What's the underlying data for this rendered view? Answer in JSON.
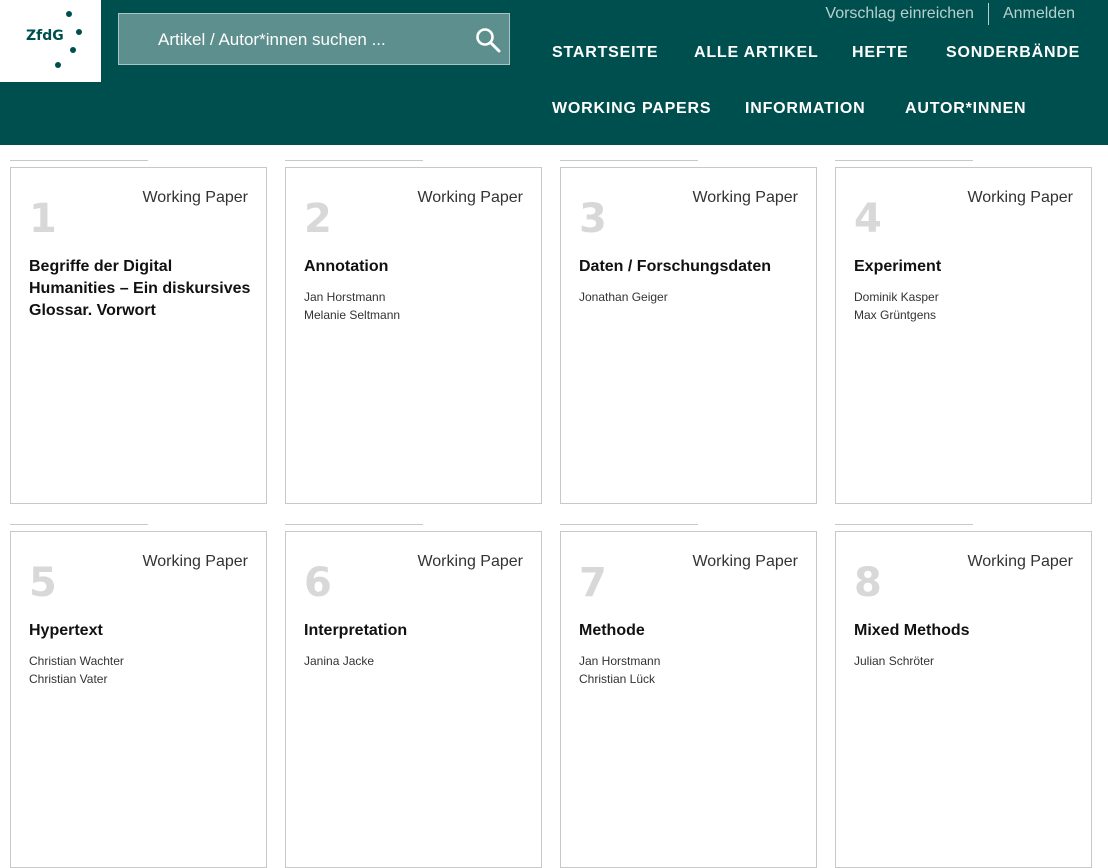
{
  "logo": {
    "text": "ZfdG"
  },
  "search": {
    "placeholder": "Artikel / Autor*innen suchen ..."
  },
  "util_links": [
    "Vorschlag einreichen",
    "Anmelden"
  ],
  "nav": {
    "row1": [
      "STARTSEITE",
      "ALLE ARTIKEL",
      "HEFTE",
      "SONDERBÄNDE"
    ],
    "row2": [
      "WORKING PAPERS",
      "INFORMATION",
      "AUTOR*INNEN"
    ]
  },
  "tiles": [
    {
      "number": "1",
      "type": "Working Paper",
      "title": "Begriffe der Digital Humanities – Ein diskursives Glossar. Vorwort",
      "authors": []
    },
    {
      "number": "2",
      "type": "Working Paper",
      "title": "Annotation",
      "authors": [
        "Jan Horstmann",
        "Melanie Seltmann"
      ]
    },
    {
      "number": "3",
      "type": "Working Paper",
      "title": "Daten / Forschungsdaten",
      "authors": [
        "Jonathan Geiger"
      ]
    },
    {
      "number": "4",
      "type": "Working Paper",
      "title": "Experiment",
      "authors": [
        "Dominik Kasper",
        "Max Grüntgens"
      ]
    },
    {
      "number": "5",
      "type": "Working Paper",
      "title": "Hypertext",
      "authors": [
        "Christian Wachter",
        "Christian Vater"
      ]
    },
    {
      "number": "6",
      "type": "Working Paper",
      "title": "Interpretation",
      "authors": [
        "Janina Jacke"
      ]
    },
    {
      "number": "7",
      "type": "Working Paper",
      "title": "Methode",
      "authors": [
        "Jan Horstmann",
        "Christian Lück"
      ]
    },
    {
      "number": "8",
      "type": "Working Paper",
      "title": "Mixed Methods",
      "authors": [
        "Julian Schröter"
      ]
    }
  ],
  "colors": {
    "brand": "#004f4f",
    "search_bg": "#5c8f8d",
    "util_text": "#b7cfcd"
  },
  "icons": {
    "search": "search-icon"
  }
}
